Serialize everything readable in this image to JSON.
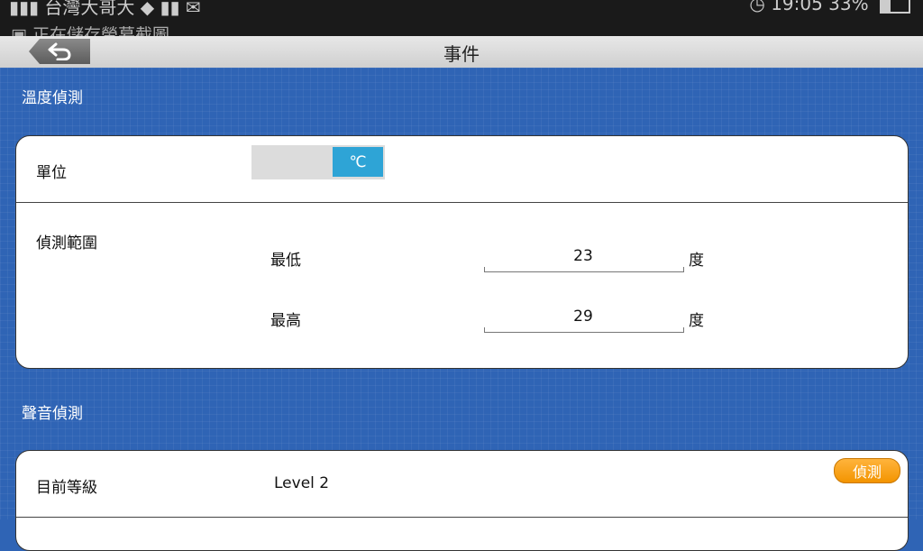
{
  "status_bar": {
    "carrier": "台灣大哥大",
    "notification": "正在儲存螢幕截圖",
    "right": "19:05 33%"
  },
  "header": {
    "title": "事件"
  },
  "temperature": {
    "section_title": "溫度偵測",
    "unit_label": "單位",
    "unit_value": "℃",
    "range_label": "偵測範圍",
    "min_label": "最低",
    "min_value": "23",
    "max_label": "最高",
    "max_value": "29",
    "degree_unit": "度"
  },
  "sound": {
    "section_title": "聲音偵測",
    "level_label": "目前等級",
    "level_value": "Level 2",
    "detect_label": "偵測"
  },
  "colors": {
    "background": "#2f64b5",
    "toggle_active": "#2ea4d6",
    "badge": "#f39400"
  }
}
